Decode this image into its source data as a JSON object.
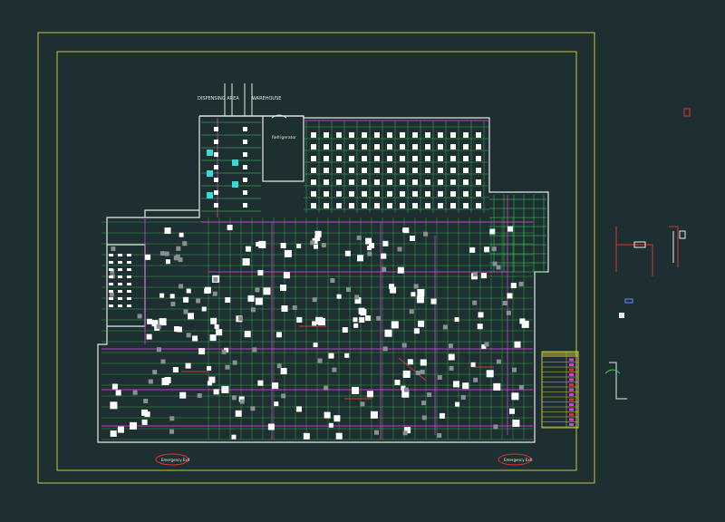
{
  "drawing": {
    "background": "#1e2f32",
    "frame_color": "#c8c43a",
    "wall_color": "#e8e8e8",
    "grid_color": "#39d24a",
    "duct_color": "#d63cd6",
    "alert_color": "#e03030",
    "fixture_color": "#ffffff"
  },
  "labels": {
    "dispensing_area": "DISPENSING AREA",
    "warehouse": "WAREHOUSE",
    "refrigerator": "Refrigerator",
    "emergency_exit_left": "Emergency Exit",
    "emergency_exit_right": "Emergency Exit"
  },
  "legend": {
    "rows": 14
  }
}
